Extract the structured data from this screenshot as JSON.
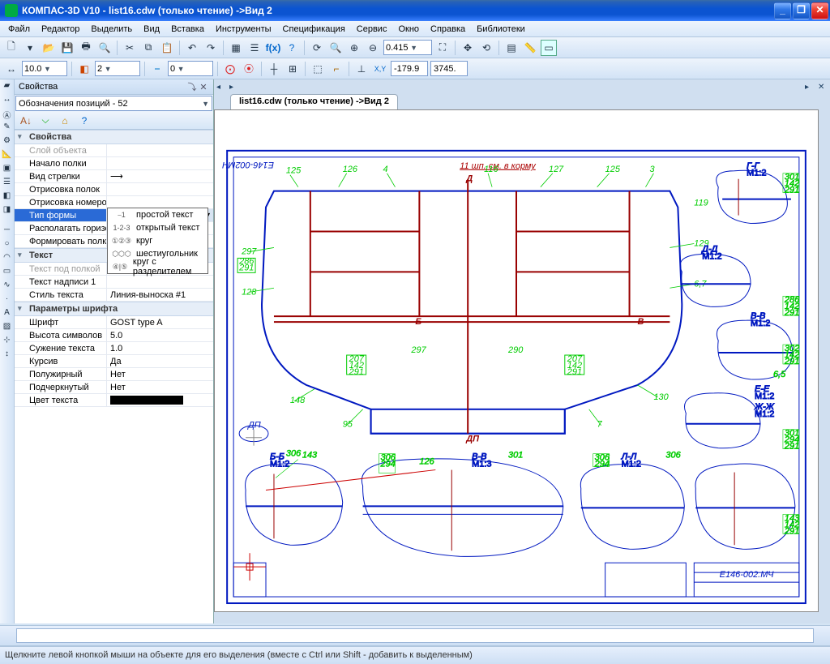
{
  "title": "КОМПАС-3D V10 - list16.cdw (только чтение) ->Вид 2",
  "menu": [
    "Файл",
    "Редактор",
    "Выделить",
    "Вид",
    "Вставка",
    "Инструменты",
    "Спецификация",
    "Сервис",
    "Окно",
    "Справка",
    "Библиотеки"
  ],
  "toolbar2": {
    "scale_combo": "10.0",
    "layer_combo": "2",
    "num_combo": "0",
    "coord_x": "-179.9",
    "coord_y": "3745.",
    "zoom": "0.415"
  },
  "properties": {
    "panel_title": "Свойства",
    "object_combo": "Обозначения позиций - 52",
    "groups": {
      "g1": "Свойства",
      "g2": "Текст",
      "g3": "Параметры шрифта"
    },
    "rows": {
      "layer": {
        "l": "Слой объекта",
        "v": ""
      },
      "start": {
        "l": "Начало полки",
        "v": ""
      },
      "arrow": {
        "l": "Вид стрелки",
        "v": ""
      },
      "shelves": {
        "l": "Отрисовка полок",
        "v": ""
      },
      "nums": {
        "l": "Отрисовка номеров ...",
        "v": ""
      },
      "formtype": {
        "l": "Тип формы",
        "v": ""
      },
      "horiz": {
        "l": "Располагать горизо...",
        "v": ""
      },
      "makeshelf": {
        "l": "Формировать полку",
        "v": ""
      },
      "undertext": {
        "l": "Текст под полкой",
        "v": ""
      },
      "caption": {
        "l": "Текст надписи 1",
        "v": ""
      },
      "textstyle": {
        "l": "Стиль текста",
        "v": "Линия-выноска #1"
      },
      "font": {
        "l": "Шрифт",
        "v": "GOST type A"
      },
      "height": {
        "l": "Высота символов",
        "v": "5.0"
      },
      "narrow": {
        "l": "Сужение текста",
        "v": "1.0"
      },
      "italic": {
        "l": "Курсив",
        "v": "Да"
      },
      "bold": {
        "l": "Полужирный",
        "v": "Нет"
      },
      "under": {
        "l": "Подчеркнутый",
        "v": "Нет"
      },
      "color": {
        "l": "Цвет текста",
        "v": ""
      }
    }
  },
  "dropdown": [
    {
      "icon": "⎯1",
      "label": "простой текст"
    },
    {
      "icon": "1-2-3",
      "label": "открытый текст"
    },
    {
      "icon": "①②③",
      "label": "круг"
    },
    {
      "icon": "⬡⬡⬡",
      "label": "шестиугольник"
    },
    {
      "icon": "④|⑤",
      "label": "круг с разделителем"
    }
  ],
  "doc": {
    "tab": "list16.cdw (только чтение) ->Вид 2",
    "title_block": "E146-002.МЧ",
    "top_left": "E146-002МЧ",
    "top_center": "11 шп. см. в корму",
    "sections": {
      "bb": "Б-Б\nМ1:2",
      "vv": "В-В\nМ1:3",
      "gg": "Г-Г\nМ1:2",
      "dd": "Д-Д\nМ1:2",
      "ee": "Е-Е\nМ1:2",
      "ll": "Л-Л\nМ1:2",
      "zhzh": "Ж-Ж\nМ1:2"
    },
    "dp": "ДП"
  },
  "statusbar": "Щелкните левой кнопкой мыши на объекте для его выделения (вместе с Ctrl или Shift - добавить к выделенным)"
}
